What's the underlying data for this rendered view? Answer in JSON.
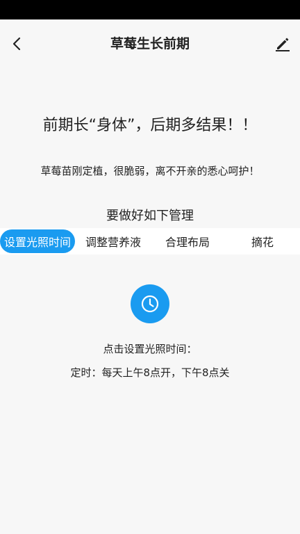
{
  "header": {
    "title": "草莓生长前期"
  },
  "content": {
    "headline": "前期长“身体”，后期多结果！！",
    "subline": "草莓苗刚定植，很脆弱，离不开亲的悉心呵护！",
    "section_title": "要做好如下管理"
  },
  "tabs": [
    {
      "label": "设置光照时间",
      "active": true
    },
    {
      "label": "调整营养液",
      "active": false
    },
    {
      "label": "合理布局",
      "active": false
    },
    {
      "label": "摘花",
      "active": false
    }
  ],
  "panel": {
    "icon": "clock-icon",
    "hint": "点击设置光照时间：",
    "schedule": "定时：每天上午8点开，下午8点关"
  },
  "colors": {
    "accent": "#1a9bf0",
    "background": "#f7f7f7",
    "status_bar": "#000000"
  }
}
